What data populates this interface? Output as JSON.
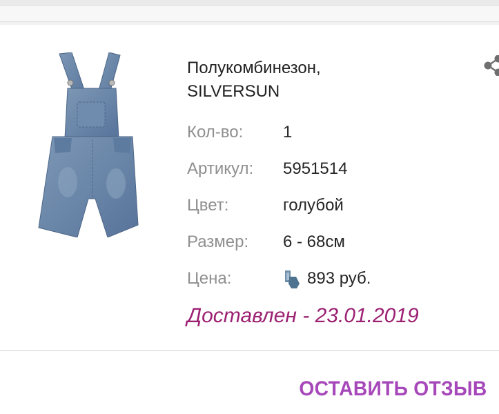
{
  "product": {
    "title_line1": "Полукомбинезон,",
    "title_line2": "SILVERSUN",
    "image_icon": "denim-overalls-product-photo"
  },
  "details": {
    "qty_label": "Кол-во:",
    "qty_value": "1",
    "article_label": "Артикул:",
    "article_value": "5951514",
    "color_label": "Цвет:",
    "color_value": "голубой",
    "size_label": "Размер:",
    "size_value": "6 - 68см",
    "price_label": "Цена:",
    "price_value": "893 руб.",
    "price_icon": "bonus-coin-icon"
  },
  "status": {
    "text": "Доставлен - 23.01.2019",
    "color": "#9c2173"
  },
  "actions": {
    "review_label": "ОСТАВИТЬ ОТЗЫВ",
    "review_color": "#a648b9",
    "share_icon": "share-icon"
  }
}
